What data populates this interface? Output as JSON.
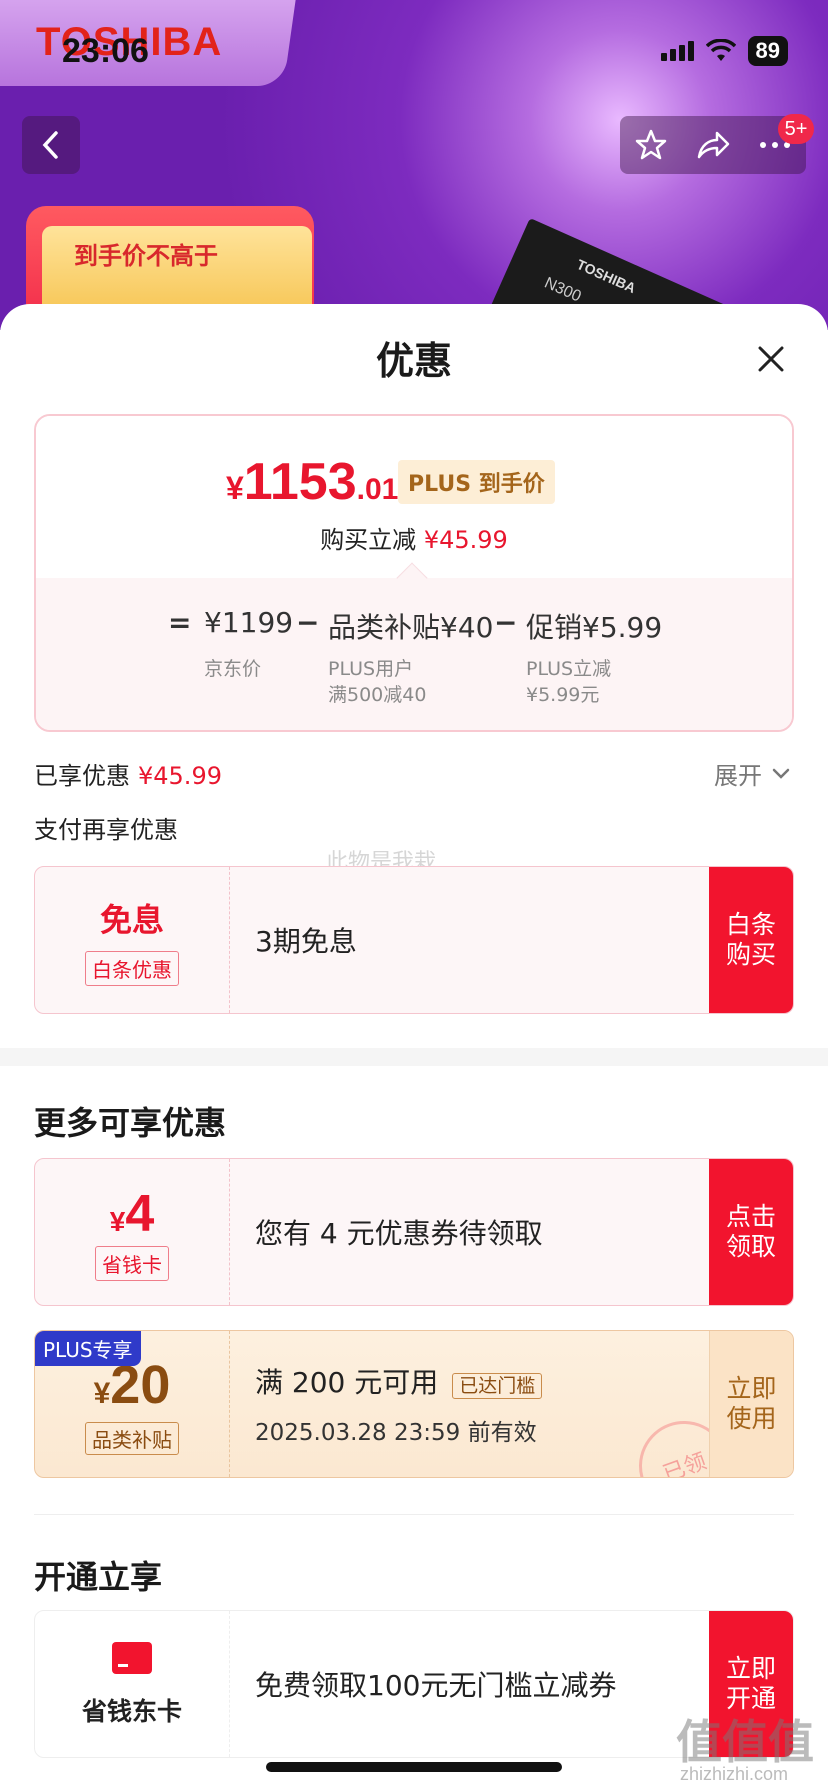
{
  "status_bar": {
    "time": "23:06",
    "battery": "89"
  },
  "hero": {
    "brand": "TOSHIBA",
    "promo_text": "到手价不高于",
    "product_brand": "TOSHIBA",
    "product_model": "N300",
    "notification_badge": "5+"
  },
  "sheet": {
    "title": "优惠",
    "price": {
      "currency": "¥",
      "integer": "1153",
      "decimal": ".01",
      "tag": "PLUS 到手价",
      "reduce_label": "购买立减",
      "reduce_amount": "¥45.99"
    },
    "breakdown": {
      "eq": "=",
      "jd_price": "¥1199",
      "minus1": "−",
      "subsidy": "品类补贴¥40",
      "minus2": "−",
      "promo": "促销¥5.99",
      "jd_price_label": "京东价",
      "subsidy_note_1": "PLUS用户",
      "subsidy_note_2": "满500减40",
      "promo_note_1": "PLUS立减",
      "promo_note_2": "¥5.99元"
    },
    "enjoyed_label": "已享优惠",
    "enjoyed_amount": "¥45.99",
    "expand_label": "展开",
    "pay_title": "支付再享优惠",
    "watermark": "此物是我栽",
    "baitiao": {
      "title": "免息",
      "tag": "白条优惠",
      "desc": "3期免息",
      "action": "白条购买"
    },
    "more_title": "更多可享优惠",
    "saver": {
      "currency": "¥",
      "amount": "4",
      "tag": "省钱卡",
      "desc": "您有 4 元优惠券待领取",
      "action": "点击领取"
    },
    "plus_coupon": {
      "badge": "PLUS专享",
      "currency": "¥",
      "amount": "20",
      "tag": "品类补贴",
      "desc": "满 200 元可用",
      "threshold": "已达门槛",
      "valid": "2025.03.28 23:59 前有效",
      "action": "立即使用",
      "stamp": "已领"
    },
    "open_title": "开通立享",
    "jdcard": {
      "name": "省钱东卡",
      "desc": "免费领取100元无门槛立减券",
      "action": "立即开通"
    }
  },
  "corner_watermark": "值值值",
  "corner_watermark_url": "zhizhizhi.com",
  "colors": {
    "accent_red": "#e8162e",
    "gold": "#8a4c11",
    "plus_blue": "#2f3ac9"
  }
}
